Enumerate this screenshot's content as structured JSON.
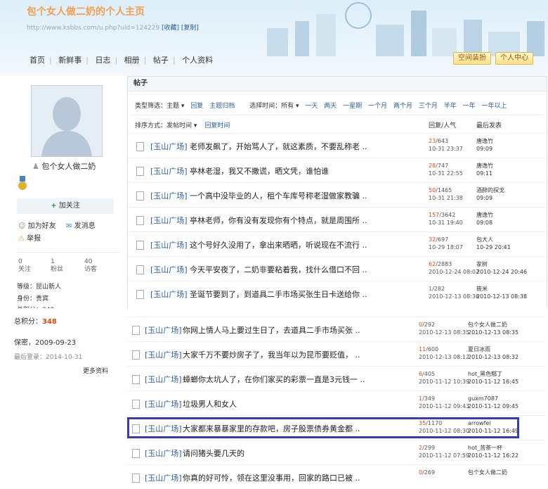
{
  "header": {
    "site_title": "包个女人做二奶的个人主页",
    "url": "http://www.ksbbs.com/u.php?uid=124229",
    "bookmark": "[收藏]",
    "copy": "[复制]",
    "nav": [
      "首页",
      "新鲜事",
      "日志",
      "相册",
      "帖子",
      "个人资料"
    ],
    "btn_space": "空间装扮",
    "btn_center": "个人中心"
  },
  "profile": {
    "name": "包个女人做二奶",
    "follow": "加关注",
    "add_friend": "加为好友",
    "message": "发消息",
    "report": "举报",
    "stats": [
      {
        "value": "0",
        "label": "关注"
      },
      {
        "value": "1",
        "label": "粉丝"
      },
      {
        "value": "40",
        "label": "访客"
      }
    ],
    "level": "等级：昆山新人",
    "identity": "身份：贵宾",
    "total_points_partial": "总积分：348",
    "total_points_label": "总积分：",
    "total_points_value": "348",
    "since": "保密，2009-09-23",
    "last_login": "最后登录：2014-10-31",
    "more": "更多资料"
  },
  "posts": {
    "section_title": "帖子",
    "filter_type_label": "类型筛选：主题",
    "filter_type_links": [
      "回复",
      "主题归档"
    ],
    "filter_time_label": "选择时间：所有",
    "filter_time_links": [
      "一天",
      "两天",
      "一星期",
      "一个月",
      "两个月",
      "三个月",
      "半年",
      "一年",
      "一年以上"
    ],
    "sort_label": "排序方式：",
    "sort_active": "发帖时间",
    "sort_other": "回复时间",
    "col_reply": "回复/人气",
    "col_last": "最后发表",
    "forum": "[玉山广场]",
    "rows_top": [
      {
        "title": "老师发飙了，开始骂人了，就这素质，不要乱称老 ..",
        "replies": "23",
        "views": "/643",
        "date": "10-31 23:37",
        "last_user": "唐逸竹",
        "last_time": "09:09"
      },
      {
        "title": "亭林老湿，我又不撒谎，晒文凭，谁怕谁",
        "replies": "28",
        "views": "/747",
        "date": "10-31 22:55",
        "last_user": "唐逸竹",
        "last_time": "09:11"
      },
      {
        "title": "一个高中没毕业的人，租个车库号称老湿做家教骗 ..",
        "replies": "50",
        "views": "/1465",
        "date": "10-31 21:38",
        "last_user": "酒醉的探戈",
        "last_time": "09:09"
      },
      {
        "title": "亭林老师，你有没有发现你有个特点，就是周围所 ..",
        "replies": "157",
        "views": "/3642",
        "date": "10-31 19:40",
        "last_user": "唐逸竹",
        "last_time": "09:08"
      },
      {
        "title": "这个号好久没用了，拿出来晒晒，听说现在不流行 ..",
        "replies": "32",
        "views": "/697",
        "date": "10-29 18:07",
        "last_user": "包大人",
        "last_time": "10-29 20:41"
      },
      {
        "title": "今天平安夜了，二奶非要粘着我，找什么借口不回 ..",
        "replies": "62",
        "views": "/2883",
        "date": "2010-12-24 08:02",
        "last_user": "家树",
        "last_time": "2010-12-24 20:46"
      },
      {
        "title": "圣诞节要到了，到道具二手市场买张生日卡送给你 ..",
        "replies": "1",
        "views": "/282",
        "date": "2010-12-13 08:36",
        "last_user": "筱米",
        "last_time": "2010-12-13 08:38"
      }
    ],
    "rows_bottom": [
      {
        "title": "你网上情人马上要过生日了，去道具二手市场买张 ..",
        "replies": "0",
        "views": "/292",
        "date": "2010-12-13 08:35",
        "last_user": "包个女人做二奶",
        "last_time": "2010-12-13 08:35"
      },
      {
        "title": "大家千万不要炒房子了，我当年以为昆币要贬值， ..",
        "replies": "11",
        "views": "/600",
        "date": "2010-12-13 08:12",
        "last_user": "夏日冰雨",
        "last_time": "2010-12-13 08:32"
      },
      {
        "title": "蟑螂你太坑人了，在你们家买的彩票一直是3元钱一 ..",
        "replies": "6",
        "views": "/405",
        "date": "2010-11-12 10:39",
        "last_user": "hot_黑色郁丁",
        "last_time": "2010-11-12 16:45"
      },
      {
        "title": "垃圾男人和女人",
        "replies": "1",
        "views": "/349",
        "date": "2010-11-12 09:43",
        "last_user": "guxm7087",
        "last_time": "2010-11-12 09:45"
      },
      {
        "title": "大家都来暴暴家里的存款吧，房子股票债券黄金都 ..",
        "replies": "35",
        "views": "/1170",
        "date": "2010-11-12 08:30",
        "last_user": "arrowfei",
        "last_time": "2010-11-12 16:49"
      },
      {
        "title": "请问猪头要几天的",
        "replies": "2",
        "views": "/299",
        "date": "2010-11-12 07:59",
        "last_user": "hot_苦茶一杯",
        "last_time": "2010-11-12 16:22"
      },
      {
        "title": "你真的好可怜，领在这里没事用，回家的路口已被 ..",
        "replies": "0",
        "views": "/269",
        "date": "",
        "last_user": "包个女人做二奶",
        "last_time": ""
      }
    ]
  },
  "colors": {
    "accent": "#2b5e9e",
    "reply_count": "#e04a10",
    "highlight": "#3a3ab8",
    "title": "#f0a050"
  }
}
